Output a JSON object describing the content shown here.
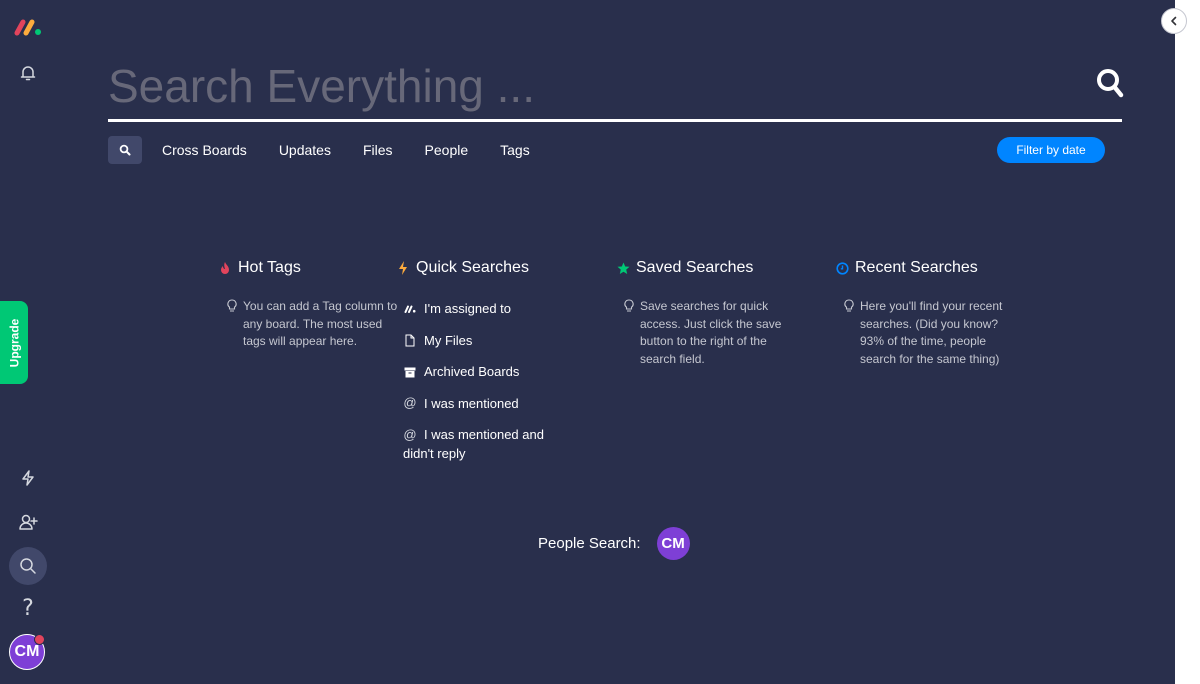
{
  "search": {
    "placeholder": "Search Everything ..."
  },
  "tabs": [
    "Cross Boards",
    "Updates",
    "Files",
    "People",
    "Tags"
  ],
  "filter_label": "Filter by date",
  "upgrade_label": "Upgrade",
  "user_initials": "CM",
  "sections": {
    "hot_tags": {
      "title": "Hot Tags",
      "hint": "You can add a Tag column to any board. The most used tags will appear here."
    },
    "quick_searches": {
      "title": "Quick Searches",
      "items": [
        {
          "label": "I'm assigned to",
          "icon": "monday-logo-icon"
        },
        {
          "label": "My Files",
          "icon": "file-icon"
        },
        {
          "label": "Archived Boards",
          "icon": "archive-icon"
        },
        {
          "label": "I was mentioned",
          "icon": "at-icon"
        },
        {
          "label": "I was mentioned and didn't reply",
          "icon": "at-icon"
        }
      ]
    },
    "saved_searches": {
      "title": "Saved Searches",
      "hint": "Save searches for quick access. Just click the save button to the right of the search field."
    },
    "recent_searches": {
      "title": "Recent Searches",
      "hint": "Here you'll find your recent searches. (Did you know? 93% of the time, people search for the same thing)"
    }
  },
  "people_search_label": "People Search:",
  "colors": {
    "background": "#292f4c",
    "accent": "#0085ff",
    "upgrade": "#00c875",
    "hot": "#e2445c",
    "quick": "#fdab3d",
    "saved": "#00c875",
    "recent": "#0085ff",
    "avatar": "#7e3fd6"
  }
}
